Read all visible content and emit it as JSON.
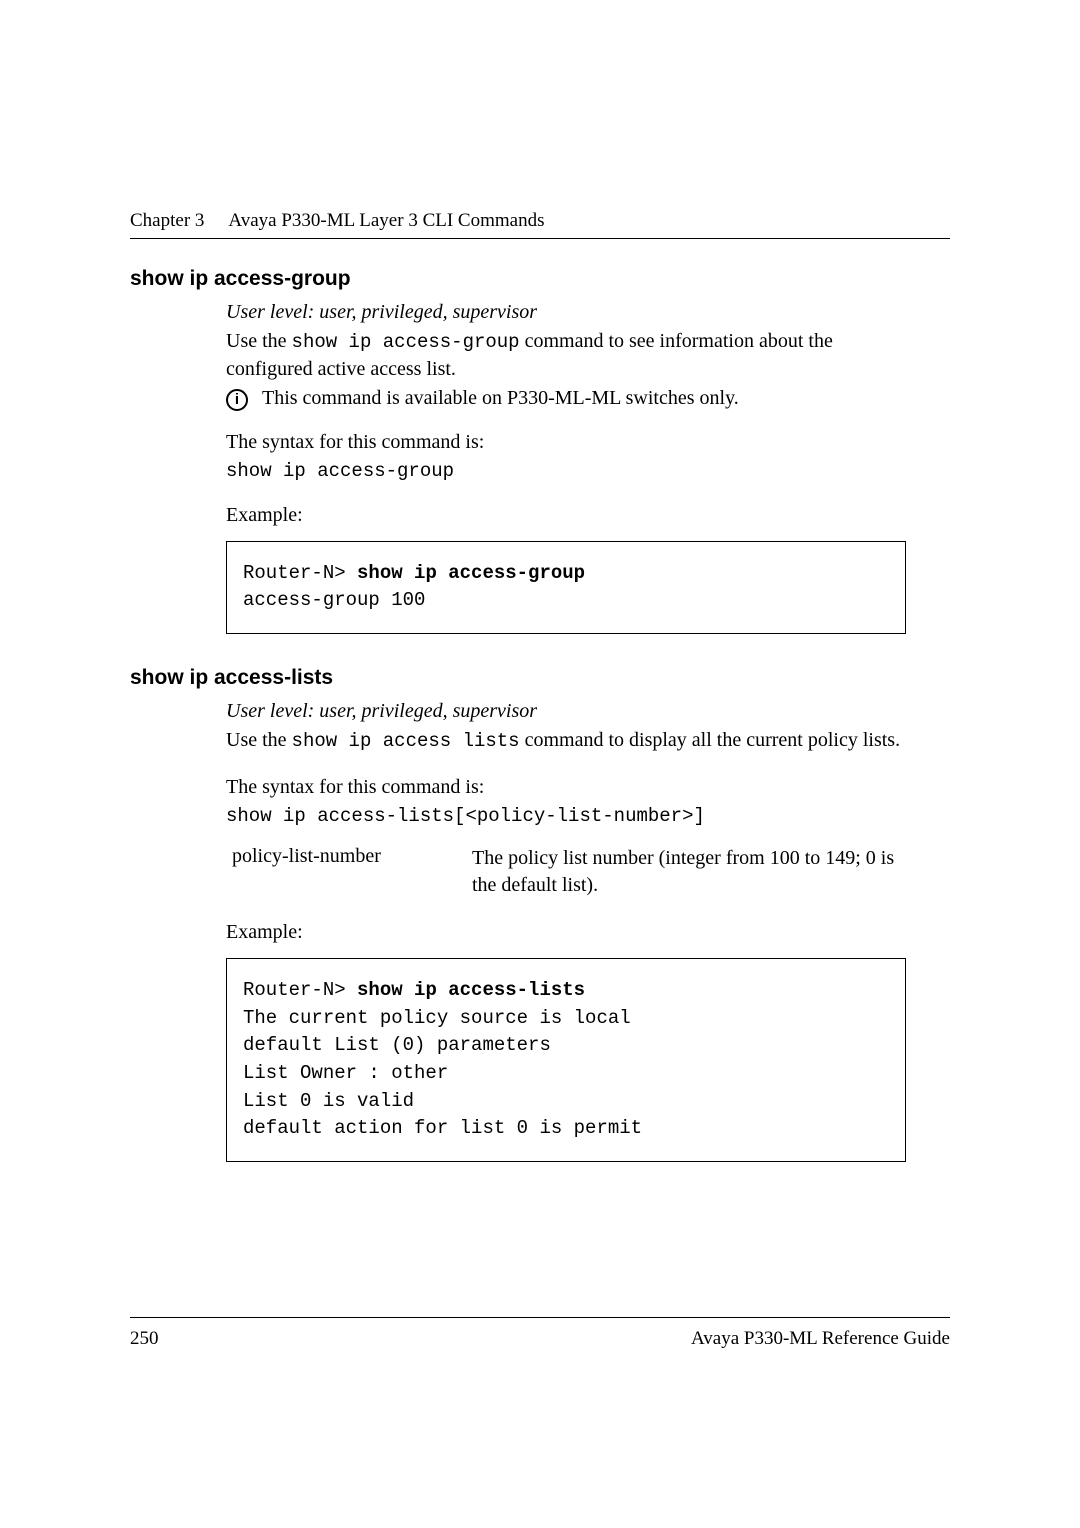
{
  "header": {
    "chapter": "Chapter 3",
    "title": "Avaya P330-ML Layer 3 CLI Commands"
  },
  "section1": {
    "title": "show ip access-group",
    "user_level": "User level: user, privileged, supervisor",
    "use_prefix": "Use the ",
    "use_cmd": "show ip access-group",
    "use_suffix": " command to see information about the configured active access list.",
    "note": "This command is available on P330-ML-ML switches only.",
    "syntax_label": "The syntax for this command is:",
    "syntax_cmd": "show ip access-group",
    "example_label": "Example:",
    "code_prompt": "Router-N> ",
    "code_cmd": "show ip access-group",
    "code_out1": "access-group 100"
  },
  "section2": {
    "title": "show ip access-lists",
    "user_level": "User level: user, privileged, supervisor",
    "use_prefix": "Use the ",
    "use_cmd": "show ip access lists",
    "use_suffix": " command to display all the current policy lists.",
    "syntax_label": "The syntax for this command is:",
    "syntax_cmd": "show ip access-lists[<policy-list-number>]",
    "param_name": "policy-list-number",
    "param_desc": "The policy list number (integer from 100 to 149; 0 is the default list).",
    "example_label": "Example:",
    "code_prompt": "Router-N> ",
    "code_cmd": "show ip access-lists",
    "code_out1": "The current policy source is local",
    "code_out2": "default List (0) parameters",
    "code_out3": "List Owner : other",
    "code_out4": "List 0 is valid",
    "code_out5": "default action for list 0 is permit"
  },
  "footer": {
    "page": "250",
    "doc": "Avaya P330-ML Reference Guide"
  }
}
